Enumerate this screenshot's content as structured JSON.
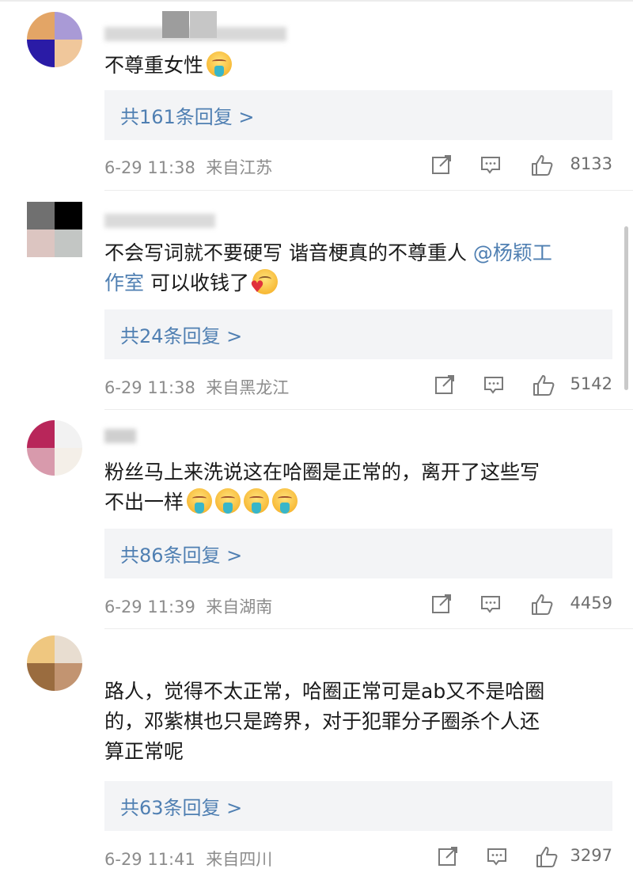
{
  "colors": {
    "link": "#4f7fb2",
    "reply_bg": "#f3f4f6",
    "meta": "#8c8c8c"
  },
  "icons": {
    "share": "share-icon",
    "comment": "comment-icon",
    "like": "thumbs-up-icon"
  },
  "comments": [
    {
      "text_parts": [
        "不尊重女性"
      ],
      "emojis": [
        "puke"
      ],
      "reply_label": "共161条回复 >",
      "time": "6-29 11:38",
      "location": "来自江苏",
      "likes": "8133"
    },
    {
      "text_lines": [
        "不会写词就不要硬写 谐音梗真的不尊重人 ",
        "可以收钱了"
      ],
      "mention_line1": "@杨颖工",
      "mention_line2": "作室",
      "emojis": [
        "heart"
      ],
      "reply_label": "共24条回复 >",
      "time": "6-29 11:38",
      "location": "来自黑龙江",
      "likes": "5142"
    },
    {
      "text_lines": [
        "粉丝马上来洗说这在哈圈是正常的，离开了这些写",
        "不出一样"
      ],
      "emojis": [
        "puke",
        "puke",
        "puke",
        "puke"
      ],
      "reply_label": "共86条回复 >",
      "time": "6-29 11:39",
      "location": "来自湖南",
      "likes": "4459"
    },
    {
      "text_lines": [
        "路人，觉得不太正常，哈圈正常可是ab又不是哈圈",
        "的，邓紫棋也只是跨界，对于犯罪分子圈杀个人还",
        "算正常呢"
      ],
      "reply_label": "共63条回复 >",
      "time": "6-29 11:41",
      "location": "来自四川",
      "likes": "3297"
    }
  ]
}
